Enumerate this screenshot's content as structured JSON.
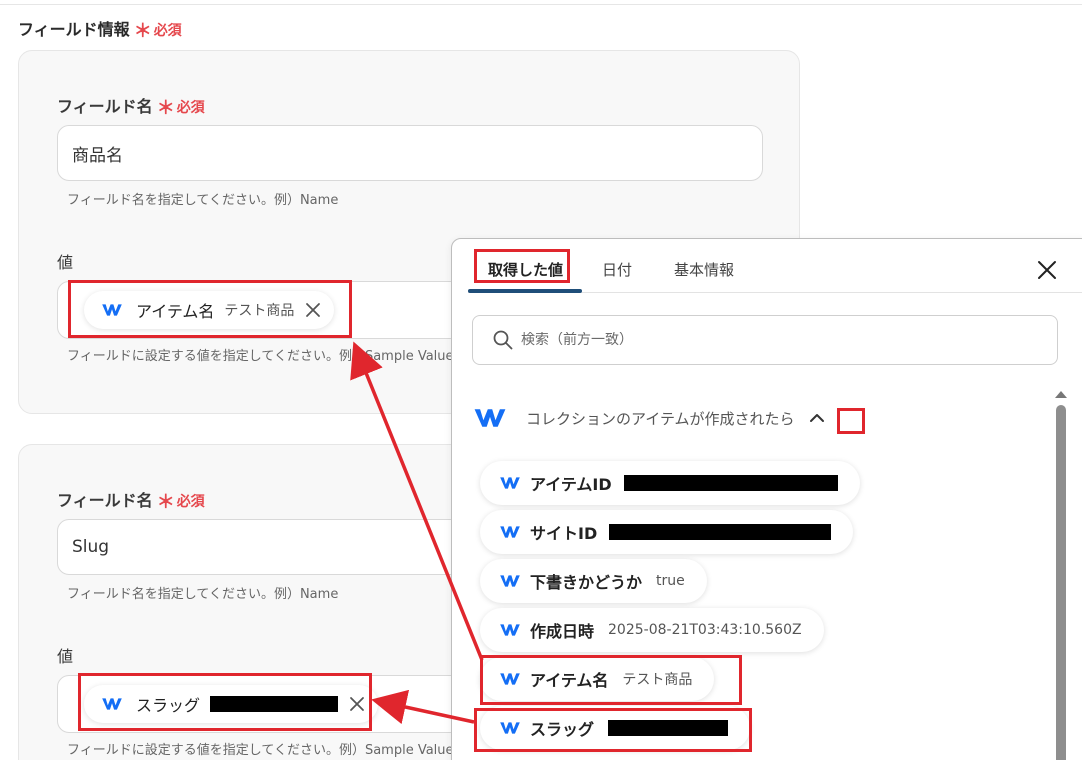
{
  "section": {
    "title": "フィールド情報",
    "required": "必須",
    "required_mark": "＊"
  },
  "field1": {
    "name_label": "フィールド名",
    "name_value": "商品名",
    "name_hint": "フィールド名を指定してください。例）Name",
    "value_label": "値",
    "chip_name": "アイテム名",
    "chip_value": "テスト商品",
    "value_hint": "フィールドに設定する値を指定してください。例）Sample Value"
  },
  "field2": {
    "name_label": "フィールド名",
    "name_value": "Slug",
    "name_hint": "フィールド名を指定してください。例）Name",
    "value_label": "値",
    "chip_name": "スラッグ",
    "value_hint": "フィールドに設定する値を指定してください。例）Sample Value"
  },
  "popup": {
    "tabs": [
      "取得した値",
      "日付",
      "基本情報"
    ],
    "search_placeholder": "検索（前方一致）",
    "group_title": "コレクションのアイテムが作成されたら",
    "items": [
      {
        "name": "アイテムID",
        "value": ""
      },
      {
        "name": "サイトID",
        "value": ""
      },
      {
        "name": "下書きかどうか",
        "value": "true"
      },
      {
        "name": "作成日時",
        "value": "2025-08-21T03:43:10.560Z"
      },
      {
        "name": "アイテム名",
        "value": "テスト商品"
      },
      {
        "name": "スラッグ",
        "value": ""
      }
    ]
  },
  "colors": {
    "required": "#e5484d",
    "highlight": "#e0262d",
    "tab_underline": "#1f4e79",
    "webflow_blue": "#146ef5"
  },
  "icons": {
    "webflow": "webflow-logo-icon",
    "close": "close-icon",
    "search": "search-icon",
    "chevron": "chevron-up-icon",
    "remove": "remove-chip-icon"
  }
}
